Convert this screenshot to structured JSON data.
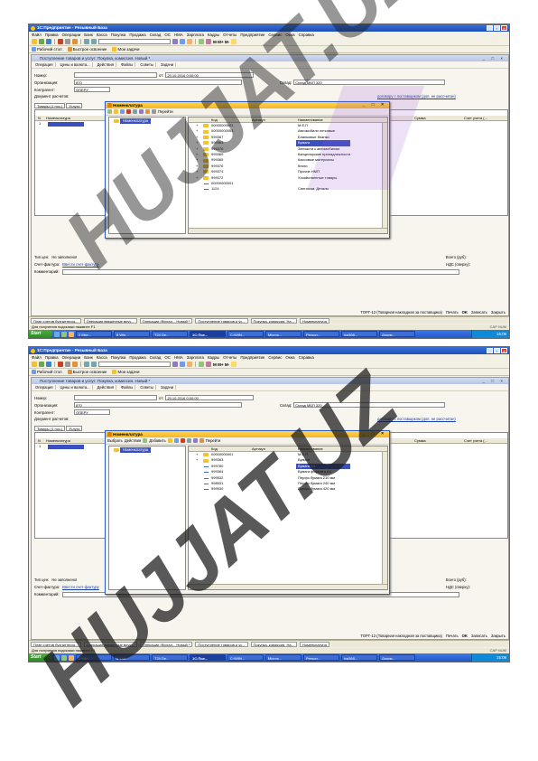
{
  "app": {
    "title": "1С:Предприятие - Резывный База",
    "menu": [
      "Файл",
      "Правка",
      "Операции",
      "Банк",
      "Касса",
      "Покупка",
      "Продажа",
      "Склад",
      "ОС",
      "НМА",
      "Зарплата",
      "Кадры",
      "Отчеты",
      "Предприятие",
      "Сервис",
      "Окна",
      "Справка"
    ],
    "panel": {
      "desktop": "Рабочий стол",
      "quick": "Быстрое освоение",
      "tasks": "Мои задачи"
    }
  },
  "doc": {
    "title": "Поступление товаров и услуг: Покупка, комиссия. Новый *",
    "toolbar": [
      "Операция",
      "Цены и валюта...",
      "Действия",
      "Файлы",
      "Советы",
      "Задачи"
    ],
    "number_label": "Номер:",
    "date_prefix": "от:",
    "date_value": "29.10.2016 0:00:00",
    "org_label": "Организация:",
    "org_value": "870",
    "warehouse_label": "Склад:",
    "warehouse_value": "Склад МБП 320",
    "contractor_label": "Контрагент:",
    "contractor_value": "ОПЕРУ",
    "settlement_label": "Документ расчетов:",
    "settlement_link": "договору с поставщиком (доп. не рассчитан)",
    "tabs": [
      "Товары (1 поз.)",
      "Услуги"
    ],
    "grid_headers": [
      "N",
      "Номенклатура",
      "Сумма",
      "Счет учета (..."
    ],
    "row_num": "1",
    "price_type_label": "Тип цен:",
    "price_type_value": "Не заполнено!",
    "invoice_label": "Счет-фактура:",
    "invoice_link": "Ввести счет-фактуру",
    "comment_label": "Комментарий:",
    "total_label": "Всего (руб):",
    "vat_label": "НДС (сверху):",
    "form_label": "ТОРГ-12 (Товарная накладная за поставщика)",
    "print_label": "Печать",
    "ok_label": "OK",
    "save_label": "Записать",
    "close_label": "Закрыть"
  },
  "dialog": {
    "title": "Номенклатура",
    "toolbar": [
      "Выбрать",
      "Действия",
      "Добавить",
      "Перейти"
    ],
    "tree_root": "Номенклатура",
    "headers": [
      "Код",
      "Артикул",
      "Наименование"
    ]
  },
  "shot1_rows": [
    {
      "code": "00000000001",
      "name": "М.Е.П",
      "kind": "folder",
      "selected": false
    },
    {
      "code": "00000000053",
      "name": "Автомобили легковые",
      "kind": "folder",
      "selected": false
    },
    {
      "code": "999367",
      "name": "Бланковые бланки",
      "kind": "folder",
      "selected": false
    },
    {
      "code": "999363",
      "name": "Бумага",
      "kind": "folder",
      "selected": true
    },
    {
      "code": "999370",
      "name": "Запчасти к автомобилям",
      "kind": "folder",
      "selected": false
    },
    {
      "code": "999369",
      "name": "Канцелярские принадлежности",
      "kind": "folder",
      "selected": false
    },
    {
      "code": "999365",
      "name": "Кассовые материалы",
      "kind": "folder",
      "selected": false
    },
    {
      "code": "999376",
      "name": "Книги",
      "kind": "folder",
      "selected": false
    },
    {
      "code": "999374",
      "name": "Прочие НМП",
      "kind": "folder",
      "selected": false
    },
    {
      "code": "999372",
      "name": "Хозяйственные товары",
      "kind": "folder",
      "selected": false
    },
    {
      "code": "00000000001",
      "name": "",
      "kind": "item",
      "selected": false
    },
    {
      "code": "1124",
      "name": "Снеголом, Детали",
      "kind": "item",
      "selected": false
    }
  ],
  "shot2_rows": [
    {
      "code": "00000000001",
      "name": "М.Е.П",
      "kind": "folder",
      "selected": false
    },
    {
      "code": "999363",
      "name": "Бумага",
      "kind": "folder",
      "selected": false
    },
    {
      "code": "999780",
      "name": "Бумага А4",
      "kind": "item",
      "selected": true
    },
    {
      "code": "999364",
      "name": "Бумага формата А4",
      "kind": "item",
      "selected": false
    },
    {
      "code": "999532",
      "name": "Перфо бумага 210 мм",
      "kind": "item",
      "selected": false
    },
    {
      "code": "998531",
      "name": "Перфо бумага 240 мм",
      "kind": "item",
      "selected": false
    },
    {
      "code": "999530",
      "name": "Перфо бумага 420 мм",
      "kind": "item",
      "selected": false
    }
  ],
  "window_tabs": [
    "План счетов бухгалтерск...",
    "Операции введенные вруч...",
    "Операции (бухгал... Новый *",
    "Поступление товаров и ус...",
    "Покупка, комиссия. На...",
    "Номенклатура"
  ],
  "status_hint": "Для получения подсказки нажмите F1",
  "status_kb": "CAP NUM",
  "taskbar": {
    "start": "Start",
    "tasks": [
      "2 Micr...",
      "8 Win...",
      "T24 De...",
      "1С:Пре...",
      "C:\\WIN...",
      "Micros...",
      "Person...",
      "ixg368...",
      "Докум..."
    ],
    "active_index": 3,
    "clock": "15:09"
  },
  "watermark": {
    "text": "HUJJAT.UZ",
    "color": "#1a1a1a"
  },
  "colors": {
    "accent": "#3a4fc2",
    "titlebar": "#2457c7",
    "dialog_title": "#f4b720",
    "watermark_purple": "#9b59d9"
  }
}
